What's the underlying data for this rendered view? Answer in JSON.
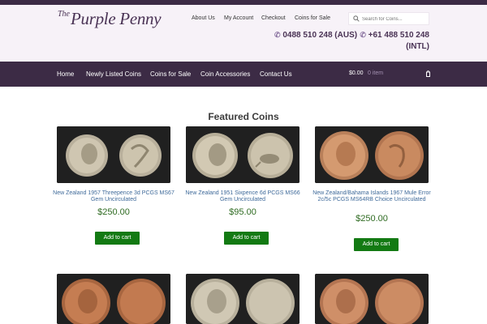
{
  "header": {
    "logo_the": "The",
    "logo_name": "Purple Penny",
    "top_links": [
      "About Us",
      "My Account",
      "Checkout",
      "Coins for Sale"
    ],
    "search_placeholder": "Search for Coins...",
    "phone_line1_a": "0488 510 248 (AUS)",
    "phone_line1_b": "+61 488 510 248",
    "phone_line2": "(INTL)"
  },
  "nav": {
    "links": [
      "Home",
      "Newly Listed Coins",
      "Coins for Sale",
      "Coin Accessories",
      "Contact Us"
    ],
    "cart_amount": "$0.00",
    "cart_items": "0 item"
  },
  "featured": {
    "title": "Featured Coins",
    "button_label": "Add to cart",
    "products": [
      {
        "title": "New Zealand 1957 Threepence 3d PCGS MS67 Gem Uncirculated",
        "price": "$250.00"
      },
      {
        "title": "New Zealand 1951 Sixpence 6d PCGS MS66 Gem Uncirculated",
        "price": "$95.00"
      },
      {
        "title": "New Zealand/Bahama Islands 1967 Mule Error 2c/5c PCGS MS64RB Choice Uncirculated",
        "price": "$250.00"
      }
    ]
  },
  "colors": {
    "brand_purple": "#3c2b45",
    "header_bg": "#f7f2f8",
    "price_green": "#2f6b22",
    "button_green": "#137a13",
    "title_blue": "#3f6a9a"
  }
}
